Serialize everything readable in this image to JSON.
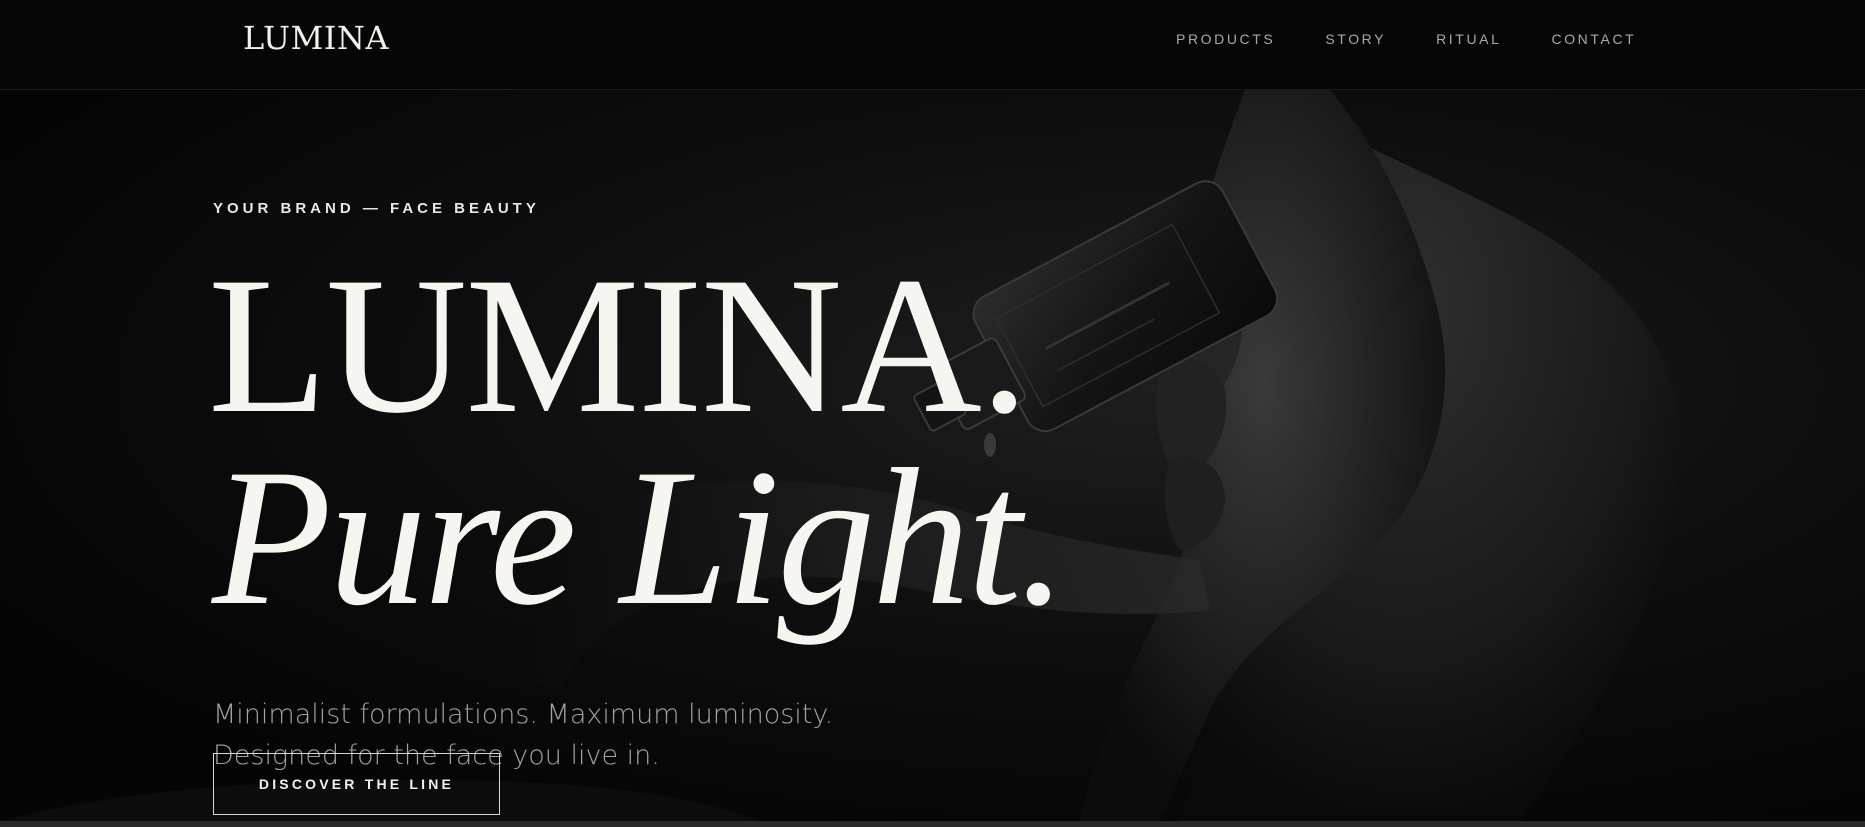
{
  "brand": {
    "logo": "LUMINA"
  },
  "nav": {
    "items": [
      {
        "label": "PRODUCTS"
      },
      {
        "label": "STORY"
      },
      {
        "label": "RITUAL"
      },
      {
        "label": "CONTACT"
      }
    ]
  },
  "hero": {
    "eyebrow": "YOUR BRAND — FACE BEAUTY",
    "headline_line1": "LUMINA.",
    "headline_line2": "Pure Light.",
    "subtitle_line1": "Minimalist formulations. Maximum luminosity.",
    "subtitle_line2": "Designed for the face you live in.",
    "cta_label": "DISCOVER THE LINE"
  },
  "colors": {
    "background": "#050505",
    "text": "#f7f5f0",
    "muted": "#a3a3a3",
    "nav": "#a8a8a8"
  },
  "icons": {
    "hero_image": "hand-holding-serum-bottle"
  }
}
